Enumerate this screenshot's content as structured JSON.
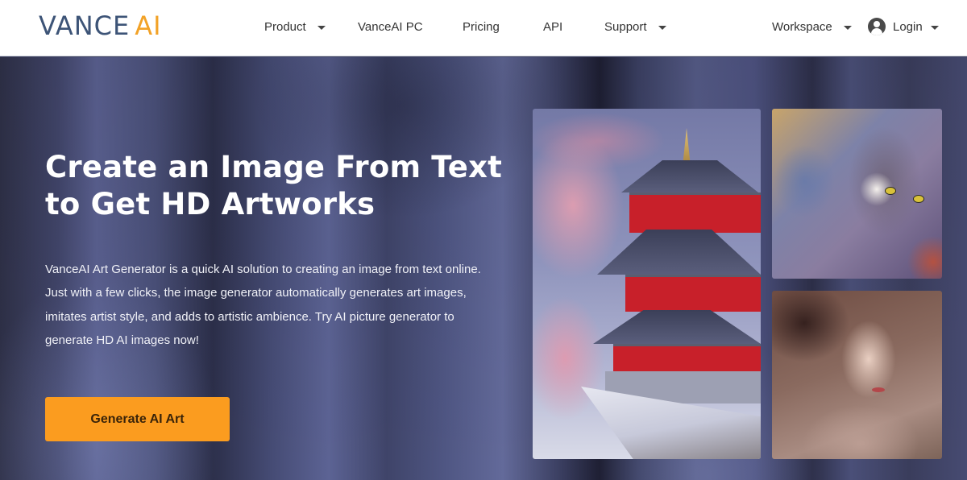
{
  "header": {
    "logo": {
      "primary": "VANCE",
      "accent": "AI"
    },
    "nav": [
      {
        "label": "Product",
        "has_dropdown": true
      },
      {
        "label": "VanceAI PC",
        "has_dropdown": false
      },
      {
        "label": "Pricing",
        "has_dropdown": false
      },
      {
        "label": "API",
        "has_dropdown": false
      },
      {
        "label": "Support",
        "has_dropdown": true
      }
    ],
    "workspace": {
      "label": "Workspace",
      "has_dropdown": true
    },
    "login": {
      "label": "Login",
      "icon": "user-circle-icon",
      "has_dropdown": true
    }
  },
  "hero": {
    "title_line1": "Create an Image From Text",
    "title_line2": "to Get HD Artworks",
    "description": "VanceAI Art Generator is a quick AI solution to creating an image from text online. Just with a few clicks, the image generator automatically generates art images, imitates artist style, and adds to artistic ambience. Try AI picture generator to generate HD AI images now!",
    "cta_label": "Generate AI Art"
  },
  "gallery": [
    {
      "subject": "pagoda-with-cherry-blossoms"
    },
    {
      "subject": "cat-portrait"
    },
    {
      "subject": "woman-portrait"
    }
  ],
  "colors": {
    "logo_primary": "#3d5477",
    "logo_accent": "#f2a227",
    "cta_background": "#fb9c1f",
    "cta_text": "#3a2409",
    "header_background": "#ffffff",
    "hero_text": "#ffffff"
  }
}
